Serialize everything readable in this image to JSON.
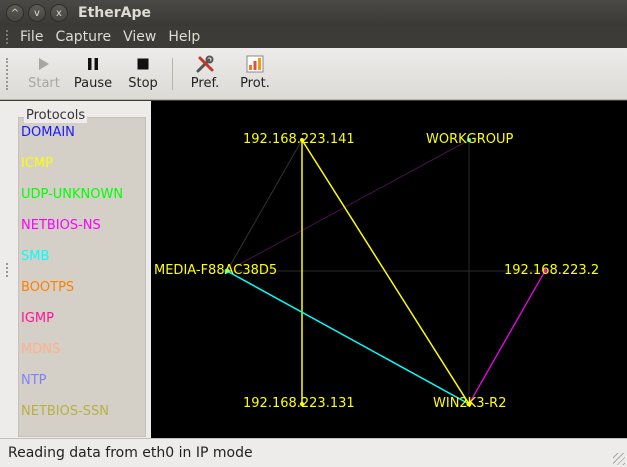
{
  "window": {
    "title": "EtherApe",
    "controls": [
      "^",
      "v",
      "x"
    ]
  },
  "menu": [
    "File",
    "Capture",
    "View",
    "Help"
  ],
  "toolbar": {
    "start_label": "Start",
    "pause_label": "Pause",
    "stop_label": "Stop",
    "pref_label": "Pref.",
    "prot_label": "Prot."
  },
  "protocols": {
    "title": "Protocols",
    "items": [
      {
        "name": "DOMAIN",
        "color": "#1a1aff"
      },
      {
        "name": "ICMP",
        "color": "#ffff00"
      },
      {
        "name": "UDP-UNKNOWN",
        "color": "#00ff00"
      },
      {
        "name": "NETBIOS-NS",
        "color": "#ff00ff"
      },
      {
        "name": "SMB",
        "color": "#00ffff"
      },
      {
        "name": "BOOTPS",
        "color": "#ff7f00"
      },
      {
        "name": "IGMP",
        "color": "#ff1493"
      },
      {
        "name": "MDNS",
        "color": "#ffb08a"
      },
      {
        "name": "NTP",
        "color": "#8080ff"
      },
      {
        "name": "NETBIOS-SSN",
        "color": "#b8b040"
      }
    ]
  },
  "nodes": {
    "n141": "192.168.223.141",
    "workgroup": "WORKGROUP",
    "media": "MEDIA-F88AC38D5",
    "n2": "192.168.223.2",
    "n131": "192.168.223.131",
    "win2k3": "WIN2K3-R2"
  },
  "status": {
    "text": "Reading data from eth0 in IP mode"
  }
}
